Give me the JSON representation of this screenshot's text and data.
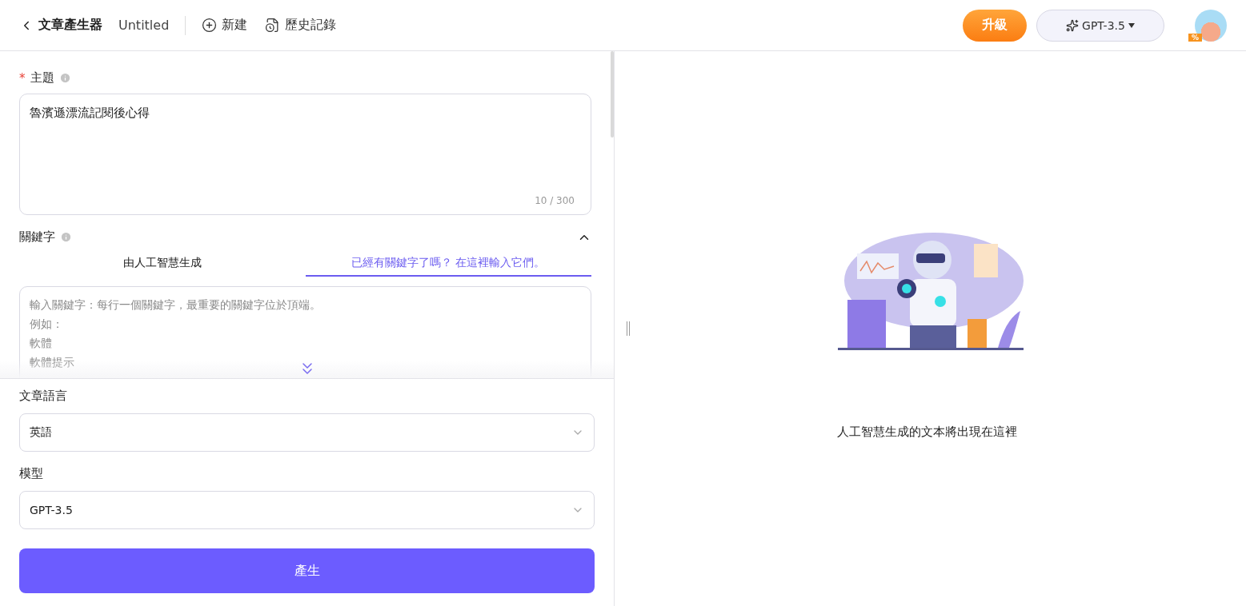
{
  "header": {
    "title": "文章產生器",
    "document_name": "Untitled",
    "actions": [
      {
        "label": "新建",
        "kind": "new"
      },
      {
        "label": "歷史記錄",
        "kind": "history"
      }
    ],
    "upgrade_button": "升級",
    "model_button": "GPT-3.5",
    "avatar_badge": "%"
  },
  "topic": {
    "required_mark": "*",
    "label": "主題",
    "value": "魯濱遜漂流記閱後心得",
    "counter": "10 / 300"
  },
  "keywords": {
    "label": "關鍵字",
    "expanded": true,
    "tabs": [
      {
        "label": "由人工智慧生成",
        "selected": false
      },
      {
        "label": "已經有關鍵字了嗎？ 在這裡輸入它們。",
        "selected": true
      }
    ],
    "placeholder_lines": [
      "輸入關鍵字：每行一個關鍵字，最重要的關鍵字位於頂端。",
      "例如：",
      "軟體",
      "軟體提示"
    ]
  },
  "language": {
    "label": "文章語言",
    "value": "英語"
  },
  "model": {
    "label": "模型",
    "value": "GPT-3.5"
  },
  "generate_button": "產生",
  "output": {
    "message": "人工智慧生成的文本將出現在這裡"
  }
}
